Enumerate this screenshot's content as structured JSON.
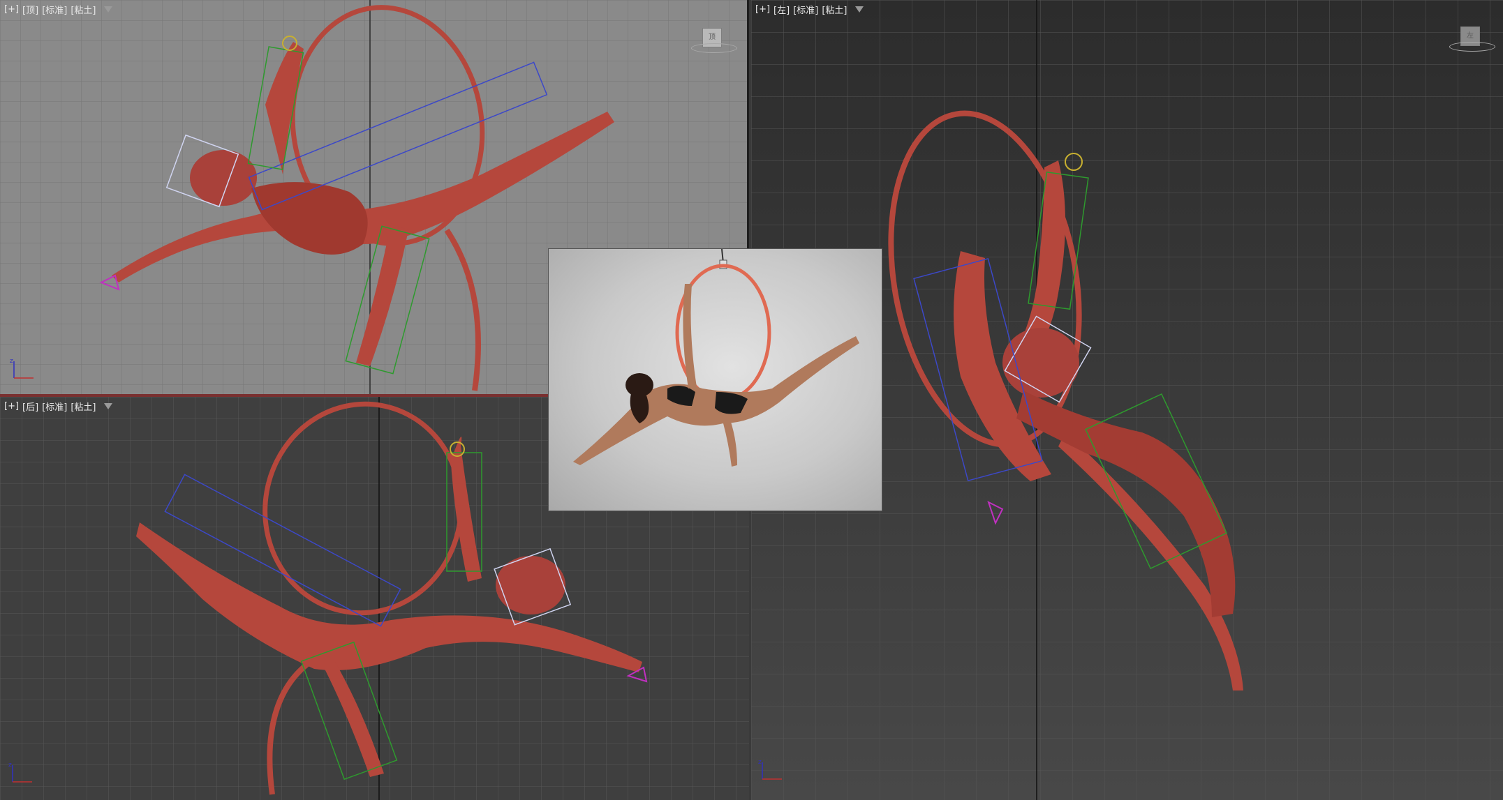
{
  "viewports": [
    {
      "id": "top",
      "label_items": [
        "[+]",
        "[顶]",
        "[标准]",
        "[粘土]"
      ],
      "viewcube_label": "顶",
      "background": "#8a8a8a",
      "grid_color": "#757575",
      "axis_color": "#2a2a2a"
    },
    {
      "id": "back",
      "label_items": [
        "[+]",
        "[后]",
        "[标准]",
        "[粘土]"
      ],
      "background": "#3f3f3f",
      "grid_color": "#555555",
      "axis_color": "#111111"
    },
    {
      "id": "left",
      "label_items": [
        "[+]",
        "[左]",
        "[标准]",
        "[粘土]"
      ],
      "viewcube_label": "左",
      "background": "#3a3a3a",
      "grid_color": "#555555",
      "axis_color": "#111111"
    }
  ],
  "colors": {
    "model_clay": "#b5473c",
    "model_shade": "#8c332b",
    "bone_blue": "#3c48c8",
    "bone_green": "#2e9a2e",
    "bone_yellow": "#c8b030",
    "active_viewport_border": "#7a3030"
  },
  "icons": {
    "filter": "funnel-icon",
    "viewcube": "viewcube-icon",
    "axis": "axis-tripod-icon"
  },
  "reference_image": {
    "subject": "aerial hoop performer photo"
  }
}
